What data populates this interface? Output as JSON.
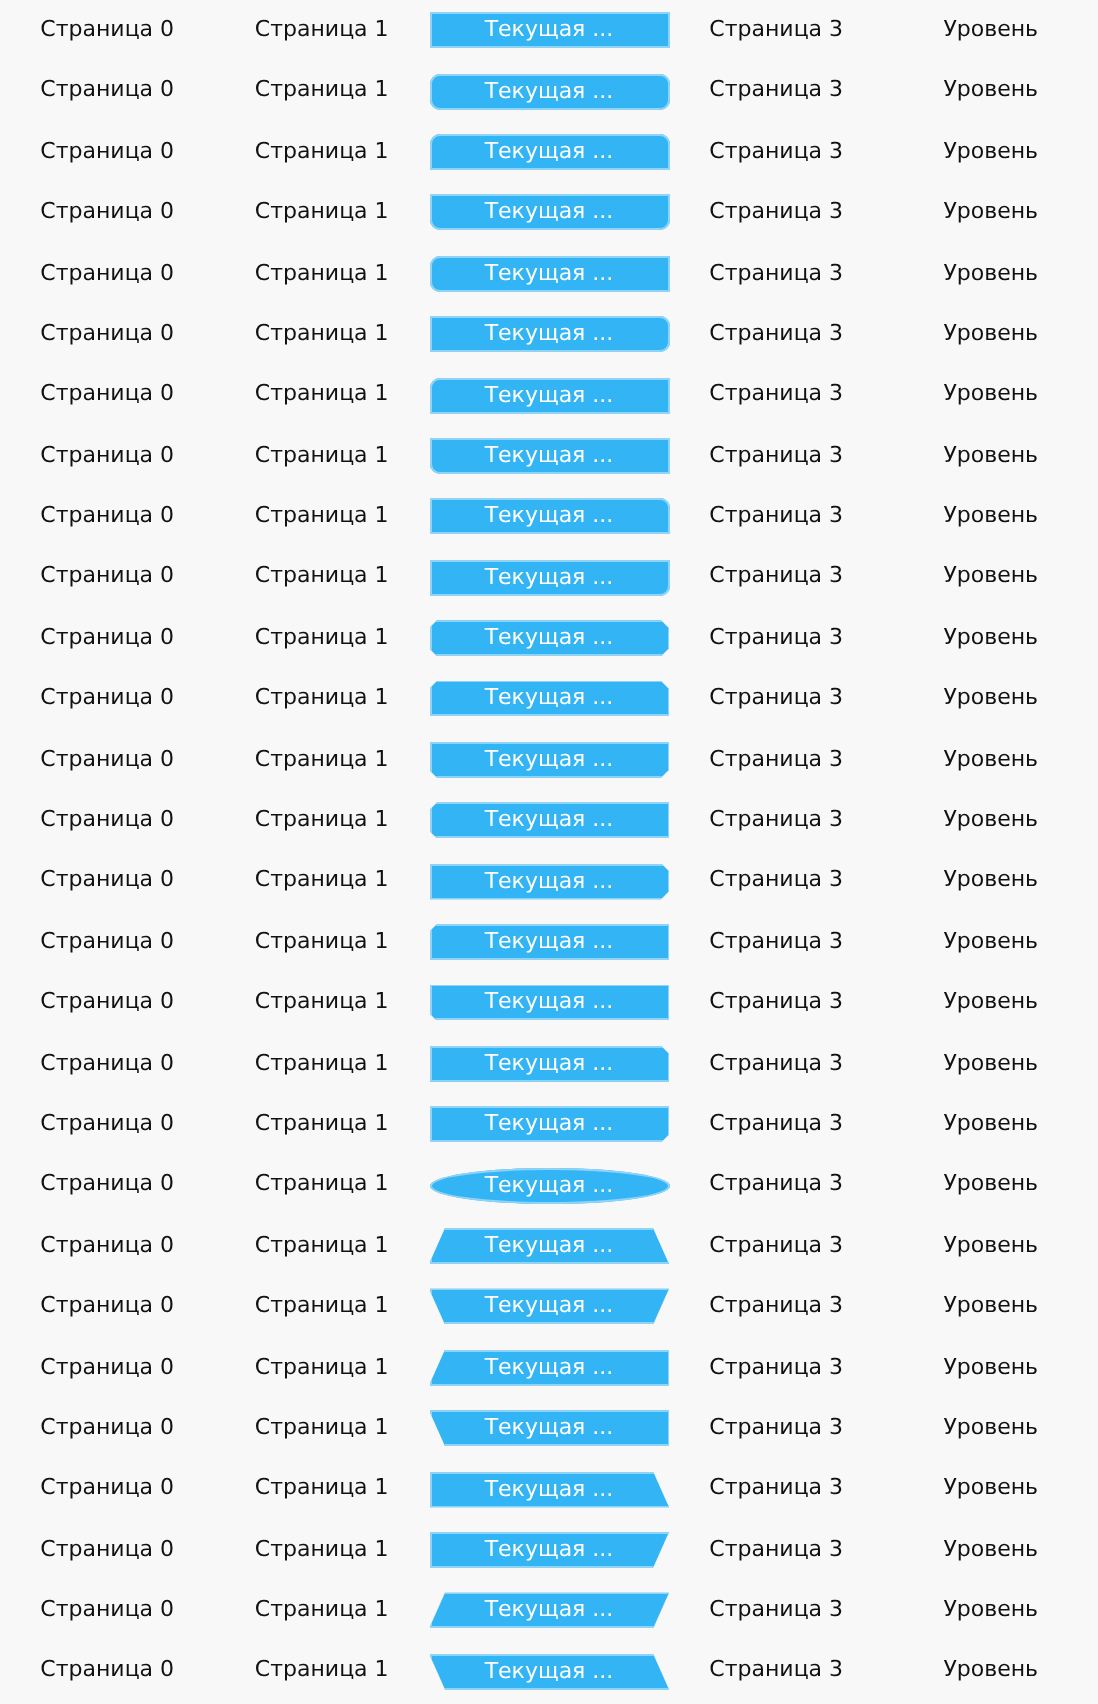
{
  "rows": [
    {
      "kind": "rect",
      "tabs": [
        {
          "label": "Страница 0",
          "selected": false
        },
        {
          "label": "Страница 1",
          "selected": false
        },
        {
          "label": "Текущая ...",
          "selected": true
        },
        {
          "label": "Страница 3",
          "selected": false
        },
        {
          "label": "Уровень",
          "selected": false
        }
      ]
    },
    {
      "kind": "round-all",
      "tabs": [
        {
          "label": "Страница 0",
          "selected": false
        },
        {
          "label": "Страница 1",
          "selected": false
        },
        {
          "label": "Текущая ...",
          "selected": true
        },
        {
          "label": "Страница 3",
          "selected": false
        },
        {
          "label": "Уровень",
          "selected": false
        }
      ]
    },
    {
      "kind": "round-top",
      "tabs": [
        {
          "label": "Страница 0",
          "selected": false
        },
        {
          "label": "Страница 1",
          "selected": false
        },
        {
          "label": "Текущая ...",
          "selected": true
        },
        {
          "label": "Страница 3",
          "selected": false
        },
        {
          "label": "Уровень",
          "selected": false
        }
      ]
    },
    {
      "kind": "round-bottom",
      "tabs": [
        {
          "label": "Страница 0",
          "selected": false
        },
        {
          "label": "Страница 1",
          "selected": false
        },
        {
          "label": "Текущая ...",
          "selected": true
        },
        {
          "label": "Страница 3",
          "selected": false
        },
        {
          "label": "Уровень",
          "selected": false
        }
      ]
    },
    {
      "kind": "round-left",
      "tabs": [
        {
          "label": "Страница 0",
          "selected": false
        },
        {
          "label": "Страница 1",
          "selected": false
        },
        {
          "label": "Текущая ...",
          "selected": true
        },
        {
          "label": "Страница 3",
          "selected": false
        },
        {
          "label": "Уровень",
          "selected": false
        }
      ]
    },
    {
      "kind": "round-right",
      "tabs": [
        {
          "label": "Страница 0",
          "selected": false
        },
        {
          "label": "Страница 1",
          "selected": false
        },
        {
          "label": "Текущая ...",
          "selected": true
        },
        {
          "label": "Страница 3",
          "selected": false
        },
        {
          "label": "Уровень",
          "selected": false
        }
      ]
    },
    {
      "kind": "round-tl",
      "tabs": [
        {
          "label": "Страница 0",
          "selected": false
        },
        {
          "label": "Страница 1",
          "selected": false
        },
        {
          "label": "Текущая ...",
          "selected": true
        },
        {
          "label": "Страница 3",
          "selected": false
        },
        {
          "label": "Уровень",
          "selected": false
        }
      ]
    },
    {
      "kind": "round-bl",
      "tabs": [
        {
          "label": "Страница 0",
          "selected": false
        },
        {
          "label": "Страница 1",
          "selected": false
        },
        {
          "label": "Текущая ...",
          "selected": true
        },
        {
          "label": "Страница 3",
          "selected": false
        },
        {
          "label": "Уровень",
          "selected": false
        }
      ]
    },
    {
      "kind": "round-tr",
      "tabs": [
        {
          "label": "Страница 0",
          "selected": false
        },
        {
          "label": "Страница 1",
          "selected": false
        },
        {
          "label": "Текущая ...",
          "selected": true
        },
        {
          "label": "Страница 3",
          "selected": false
        },
        {
          "label": "Уровень",
          "selected": false
        }
      ]
    },
    {
      "kind": "round-br",
      "tabs": [
        {
          "label": "Страница 0",
          "selected": false
        },
        {
          "label": "Страница 1",
          "selected": false
        },
        {
          "label": "Текущая ...",
          "selected": true
        },
        {
          "label": "Страница 3",
          "selected": false
        },
        {
          "label": "Уровень",
          "selected": false
        }
      ]
    },
    {
      "kind": "cut-all",
      "tabs": [
        {
          "label": "Страница 0",
          "selected": false
        },
        {
          "label": "Страница 1",
          "selected": false
        },
        {
          "label": "Текущая ...",
          "selected": true
        },
        {
          "label": "Страница 3",
          "selected": false
        },
        {
          "label": "Уровень",
          "selected": false
        }
      ]
    },
    {
      "kind": "cut-top",
      "tabs": [
        {
          "label": "Страница 0",
          "selected": false
        },
        {
          "label": "Страница 1",
          "selected": false
        },
        {
          "label": "Текущая ...",
          "selected": true
        },
        {
          "label": "Страница 3",
          "selected": false
        },
        {
          "label": "Уровень",
          "selected": false
        }
      ]
    },
    {
      "kind": "cut-bottom",
      "tabs": [
        {
          "label": "Страница 0",
          "selected": false
        },
        {
          "label": "Страница 1",
          "selected": false
        },
        {
          "label": "Текущая ...",
          "selected": true
        },
        {
          "label": "Страница 3",
          "selected": false
        },
        {
          "label": "Уровень",
          "selected": false
        }
      ]
    },
    {
      "kind": "cut-left",
      "tabs": [
        {
          "label": "Страница 0",
          "selected": false
        },
        {
          "label": "Страница 1",
          "selected": false
        },
        {
          "label": "Текущая ...",
          "selected": true
        },
        {
          "label": "Страница 3",
          "selected": false
        },
        {
          "label": "Уровень",
          "selected": false
        }
      ]
    },
    {
      "kind": "cut-right",
      "tabs": [
        {
          "label": "Страница 0",
          "selected": false
        },
        {
          "label": "Страница 1",
          "selected": false
        },
        {
          "label": "Текущая ...",
          "selected": true
        },
        {
          "label": "Страница 3",
          "selected": false
        },
        {
          "label": "Уровень",
          "selected": false
        }
      ]
    },
    {
      "kind": "cut-tl",
      "tabs": [
        {
          "label": "Страница 0",
          "selected": false
        },
        {
          "label": "Страница 1",
          "selected": false
        },
        {
          "label": "Текущая ...",
          "selected": true
        },
        {
          "label": "Страница 3",
          "selected": false
        },
        {
          "label": "Уровень",
          "selected": false
        }
      ]
    },
    {
      "kind": "cut-bl",
      "tabs": [
        {
          "label": "Страница 0",
          "selected": false
        },
        {
          "label": "Страница 1",
          "selected": false
        },
        {
          "label": "Текущая ...",
          "selected": true
        },
        {
          "label": "Страница 3",
          "selected": false
        },
        {
          "label": "Уровень",
          "selected": false
        }
      ]
    },
    {
      "kind": "cut-tr",
      "tabs": [
        {
          "label": "Страница 0",
          "selected": false
        },
        {
          "label": "Страница 1",
          "selected": false
        },
        {
          "label": "Текущая ...",
          "selected": true
        },
        {
          "label": "Страница 3",
          "selected": false
        },
        {
          "label": "Уровень",
          "selected": false
        }
      ]
    },
    {
      "kind": "cut-br",
      "tabs": [
        {
          "label": "Страница 0",
          "selected": false
        },
        {
          "label": "Страница 1",
          "selected": false
        },
        {
          "label": "Текущая ...",
          "selected": true
        },
        {
          "label": "Страница 3",
          "selected": false
        },
        {
          "label": "Уровень",
          "selected": false
        }
      ]
    },
    {
      "kind": "ellipse",
      "tabs": [
        {
          "label": "Страница 0",
          "selected": false
        },
        {
          "label": "Страница 1",
          "selected": false
        },
        {
          "label": "Текущая ...",
          "selected": true
        },
        {
          "label": "Страница 3",
          "selected": false
        },
        {
          "label": "Уровень",
          "selected": false
        }
      ]
    },
    {
      "kind": "trapezoid",
      "tabs": [
        {
          "label": "Страница 0",
          "selected": false
        },
        {
          "label": "Страница 1",
          "selected": false
        },
        {
          "label": "Текущая ...",
          "selected": true
        },
        {
          "label": "Страница 3",
          "selected": false
        },
        {
          "label": "Уровень",
          "selected": false
        }
      ]
    },
    {
      "kind": "trapezoid-down",
      "tabs": [
        {
          "label": "Страница 0",
          "selected": false
        },
        {
          "label": "Страница 1",
          "selected": false
        },
        {
          "label": "Текущая ...",
          "selected": true
        },
        {
          "label": "Страница 3",
          "selected": false
        },
        {
          "label": "Уровень",
          "selected": false
        }
      ]
    },
    {
      "kind": "slant-left",
      "tabs": [
        {
          "label": "Страница 0",
          "selected": false
        },
        {
          "label": "Страница 1",
          "selected": false
        },
        {
          "label": "Текущая ...",
          "selected": true
        },
        {
          "label": "Страница 3",
          "selected": false
        },
        {
          "label": "Уровень",
          "selected": false
        }
      ]
    },
    {
      "kind": "slant-left-down",
      "tabs": [
        {
          "label": "Страница 0",
          "selected": false
        },
        {
          "label": "Страница 1",
          "selected": false
        },
        {
          "label": "Текущая ...",
          "selected": true
        },
        {
          "label": "Страница 3",
          "selected": false
        },
        {
          "label": "Уровень",
          "selected": false
        }
      ]
    },
    {
      "kind": "slant-right",
      "tabs": [
        {
          "label": "Страница 0",
          "selected": false
        },
        {
          "label": "Страница 1",
          "selected": false
        },
        {
          "label": "Текущая ...",
          "selected": true
        },
        {
          "label": "Страница 3",
          "selected": false
        },
        {
          "label": "Уровень",
          "selected": false
        }
      ]
    },
    {
      "kind": "slant-right-down",
      "tabs": [
        {
          "label": "Страница 0",
          "selected": false
        },
        {
          "label": "Страница 1",
          "selected": false
        },
        {
          "label": "Текущая ...",
          "selected": true
        },
        {
          "label": "Страница 3",
          "selected": false
        },
        {
          "label": "Уровень",
          "selected": false
        }
      ]
    },
    {
      "kind": "parallelogram",
      "tabs": [
        {
          "label": "Страница 0",
          "selected": false
        },
        {
          "label": "Страница 1",
          "selected": false
        },
        {
          "label": "Текущая ...",
          "selected": true
        },
        {
          "label": "Страница 3",
          "selected": false
        },
        {
          "label": "Уровень",
          "selected": false
        }
      ]
    },
    {
      "kind": "parallelogram-back",
      "tabs": [
        {
          "label": "Страница 0",
          "selected": false
        },
        {
          "label": "Страница 1",
          "selected": false
        },
        {
          "label": "Текущая ...",
          "selected": true
        },
        {
          "label": "Страница 3",
          "selected": false
        },
        {
          "label": "Уровень",
          "selected": false
        }
      ]
    }
  ]
}
